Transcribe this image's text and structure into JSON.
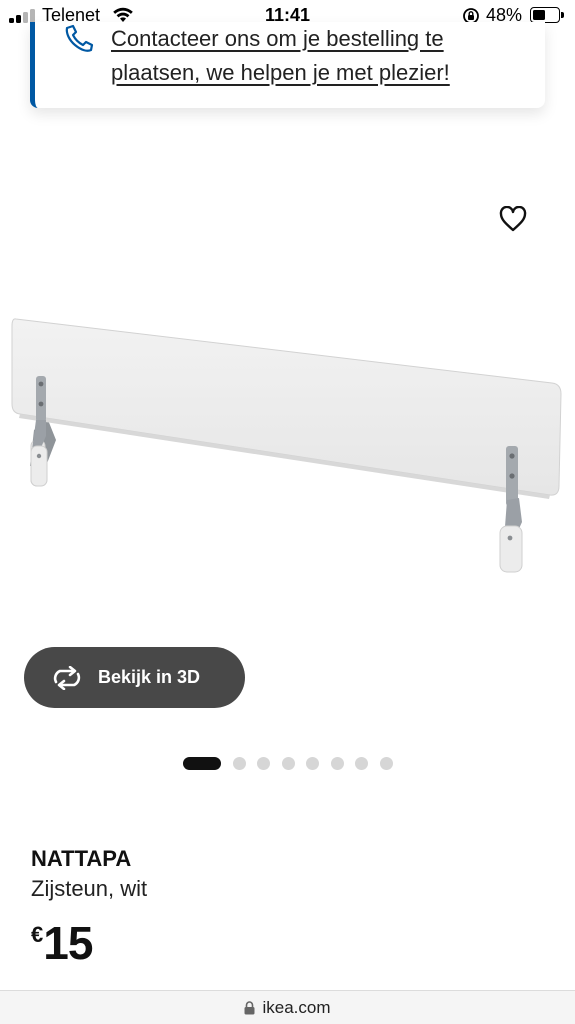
{
  "status_bar": {
    "carrier": "Telenet",
    "time": "11:41",
    "battery_percent": "48%",
    "battery_level": 0.48
  },
  "contact": {
    "text": "Contacteer ons om je bestelling te plaatsen, we helpen je met plezier!",
    "icon": "phone-icon"
  },
  "favorite": {
    "icon": "heart-icon"
  },
  "view_3d": {
    "label": "Bekijk in 3D",
    "icon": "rotate-3d-icon"
  },
  "gallery": {
    "total_images": 8,
    "active_index": 0
  },
  "product": {
    "name": "NATTAPA",
    "description": "Zijsteun, wit",
    "currency": "€",
    "price": "15"
  },
  "browser": {
    "url": "ikea.com",
    "icon": "lock-icon"
  },
  "colors": {
    "accent_blue": "#0058a3",
    "button_dark": "#484848",
    "dot_active": "#111111",
    "dot_inactive": "#d6d6d6"
  }
}
